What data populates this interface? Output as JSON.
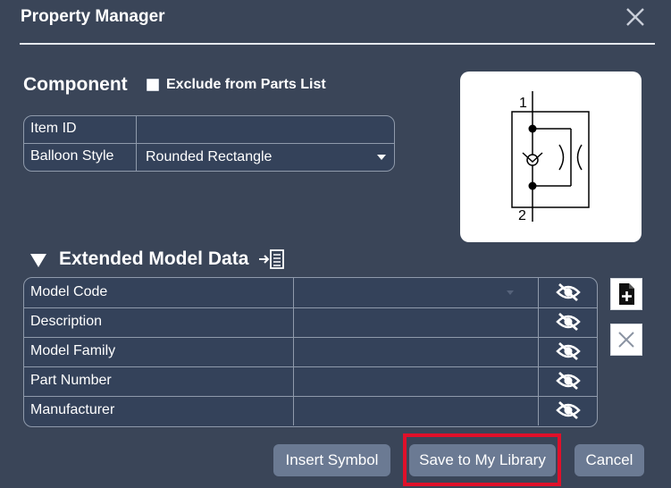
{
  "dialog": {
    "title": "Property Manager"
  },
  "component": {
    "section_title": "Component",
    "exclude_label": "Exclude from Parts List",
    "exclude_checked": false,
    "fields": [
      {
        "label": "Item ID",
        "value": ""
      },
      {
        "label": "Balloon Style",
        "value": "Rounded Rectangle"
      }
    ]
  },
  "symbol": {
    "pin_top": "1",
    "pin_bottom": "2"
  },
  "extended_model_data": {
    "title": "Extended Model Data",
    "rows": [
      {
        "label": "Model Code",
        "value": ""
      },
      {
        "label": "Description",
        "value": ""
      },
      {
        "label": "Model Family",
        "value": ""
      },
      {
        "label": "Part Number",
        "value": ""
      },
      {
        "label": "Manufacturer",
        "value": ""
      }
    ]
  },
  "buttons": {
    "insert_symbol": "Insert Symbol",
    "save_to_library": "Save to My Library",
    "cancel": "Cancel"
  },
  "icons": {
    "close": "close-icon",
    "hidden": "eye-slash-icon",
    "add_file": "file-plus-icon",
    "remove": "x-icon",
    "import": "import-list-icon"
  },
  "colors": {
    "background": "#3a4558",
    "button": "#6b7a93",
    "highlight": "#e0102a"
  }
}
